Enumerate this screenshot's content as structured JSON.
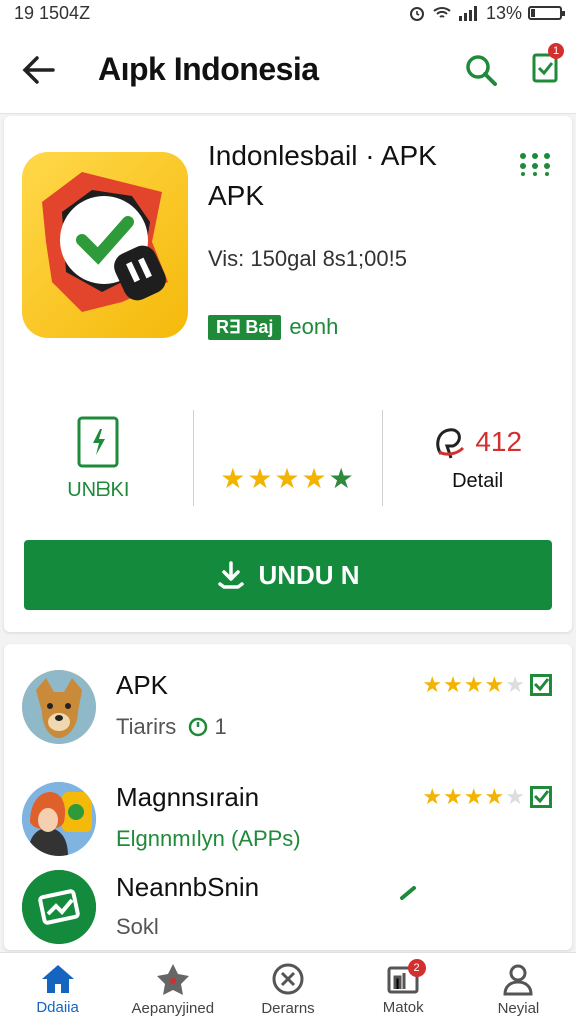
{
  "status_bar": {
    "time": "19 1504Z",
    "battery": "13%",
    "battery_level": 0.13
  },
  "app_bar": {
    "title": "Aıpk Indonesia",
    "notification_count": "1"
  },
  "app": {
    "title_line1": "Indonlesbail · APK",
    "title_line2": "APK",
    "version": "Vis: 150gal 8s1;00!5",
    "badge": "R∃ Baj",
    "badge_suffix": "eonh"
  },
  "stats": {
    "install_label": "UNᗷKI",
    "stars": "★★★★",
    "stars_last": "★",
    "rating_count": "412",
    "detail_label": "Detail"
  },
  "download_button": {
    "label": "UNDU N"
  },
  "list": [
    {
      "name": "APK",
      "sub": "Tiarirs",
      "sub_count": "1",
      "stars": "★★★★",
      "stars_half": "★"
    },
    {
      "name": "Magnnsırain",
      "sub": "Elgnnmılyn (APPs)",
      "stars": "★★★★",
      "stars_half": "★"
    },
    {
      "name": "NeannbSnin",
      "sub": "Sokl"
    }
  ],
  "bottom_nav": [
    {
      "label": "Ddaiia",
      "icon": "home-icon"
    },
    {
      "label": "Aepanyjined",
      "icon": "star-icon"
    },
    {
      "label": "Derarns",
      "icon": "cancel-icon"
    },
    {
      "label": "Matok",
      "icon": "inbox-icon",
      "badge": "2"
    },
    {
      "label": "Neyial",
      "icon": "person-icon"
    }
  ],
  "colors": {
    "accent": "#138a3c",
    "star": "#f2b400",
    "alert": "#d32f2f",
    "nav_active": "#1565c0"
  }
}
